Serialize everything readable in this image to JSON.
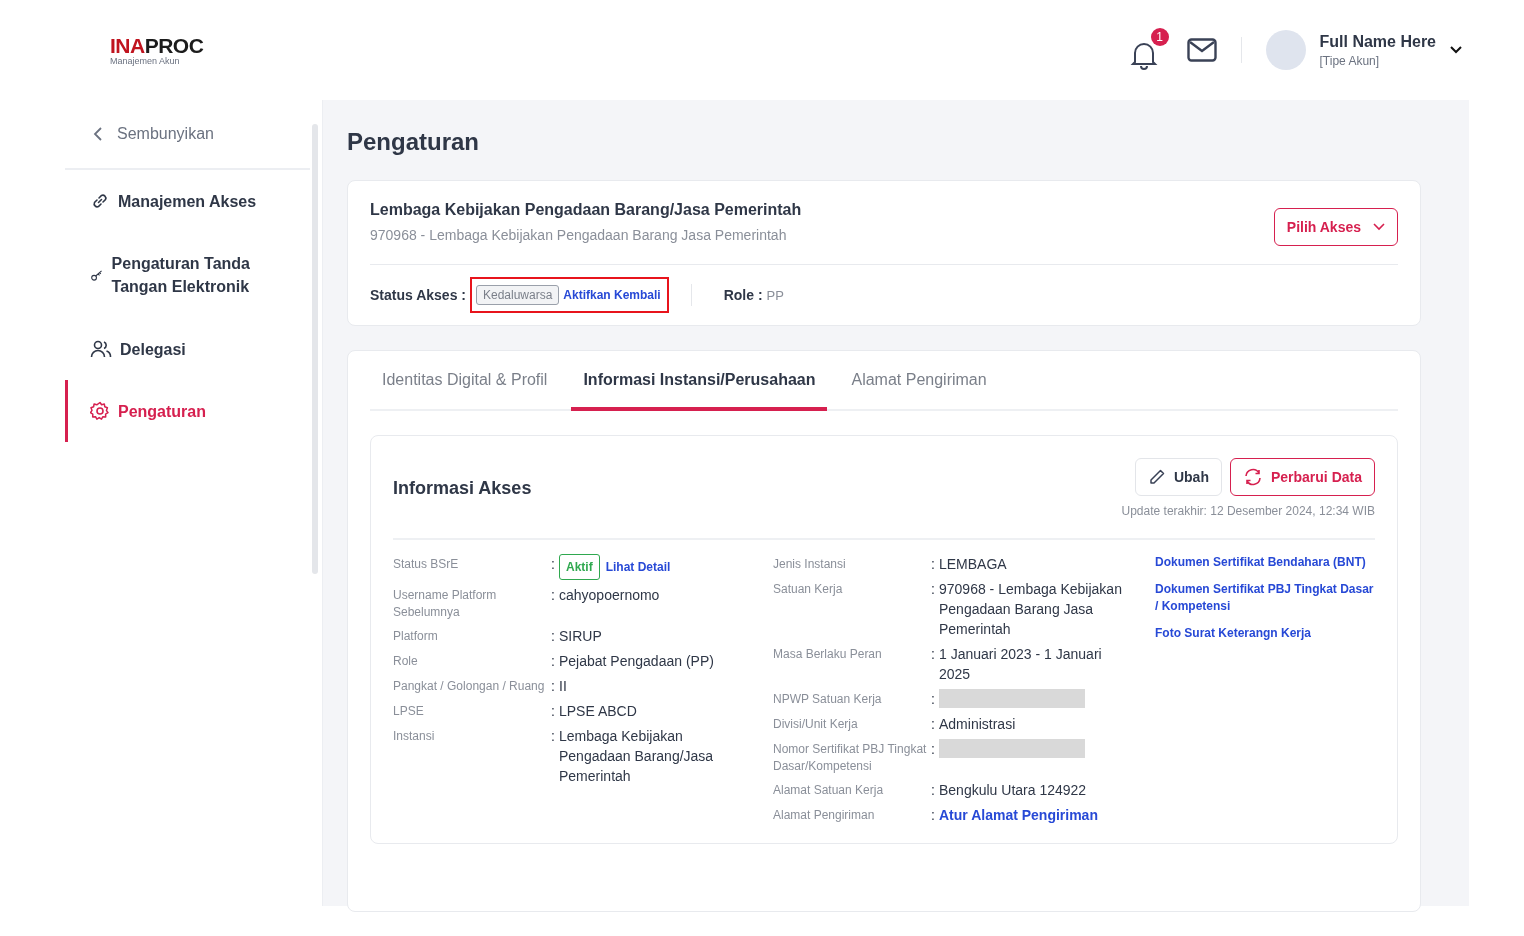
{
  "header": {
    "logo_primary": "INA",
    "logo_secondary": "PROC",
    "logo_caption": "Manajemen Akun",
    "notification_count": "1",
    "user_name": "Full Name Here",
    "user_type": "[Tipe Akun]"
  },
  "sidebar": {
    "collapse_label": "Sembunyikan",
    "items": [
      {
        "label": "Manajemen Akses",
        "kind": "access",
        "selected": false
      },
      {
        "label": "Pengaturan Tanda Tangan Elektronik",
        "kind": "signature",
        "selected": false
      },
      {
        "label": "Delegasi",
        "kind": "delegation",
        "selected": false
      },
      {
        "label": "Pengaturan",
        "kind": "settings",
        "selected": true
      }
    ]
  },
  "page_title": "Pengaturan",
  "access_card": {
    "org_name": "Lembaga Kebijakan Pengadaan Barang/Jasa Pemerintah",
    "org_code": "970968 - Lembaga Kebijakan Pengadaan Barang Jasa Pemerintah",
    "select_button": "Pilih Akses",
    "status_label": "Status Akses :",
    "status_badge": "Kedaluwarsa",
    "status_link": "Aktifkan Kembali",
    "highlighted": true,
    "role_label": "Role :",
    "role_value": "PP"
  },
  "tabs": [
    {
      "label": "Identitas Digital & Profil",
      "selected": false
    },
    {
      "label": "Informasi Instansi/Perusahaan",
      "selected": true
    },
    {
      "label": "Alamat Pengiriman",
      "selected": false
    }
  ],
  "info": {
    "title": "Informasi Akses",
    "edit_button": "Ubah",
    "refresh_button": "Perbarui Data",
    "last_update": "Update terakhir: 12 Desember 2024, 12:34 WIB",
    "separator": ":",
    "left_fields": [
      {
        "label": "Status BSrE",
        "kind": "badge",
        "badge": "Aktif",
        "link": "Lihat Detail"
      },
      {
        "label": "Username Platform Sebelumnya",
        "kind": "text",
        "value": "cahyopoernomo"
      },
      {
        "label": "Platform",
        "kind": "text",
        "value": "SIRUP"
      },
      {
        "label": "Role",
        "kind": "text",
        "value": "Pejabat Pengadaan (PP)"
      },
      {
        "label": "Pangkat / Golongan / Ruang",
        "kind": "text",
        "value": "II"
      },
      {
        "label": "LPSE",
        "kind": "text",
        "value": "LPSE ABCD"
      },
      {
        "label": "Instansi",
        "kind": "text",
        "value": "Lembaga Kebijakan Pengadaan Barang/Jasa Pemerintah"
      }
    ],
    "middle_fields": [
      {
        "label": "Jenis Instansi",
        "kind": "text",
        "value": "LEMBAGA"
      },
      {
        "label": "Satuan Kerja",
        "kind": "text",
        "value": "970968 - Lembaga Kebijakan Pengadaan Barang Jasa Pemerintah"
      },
      {
        "label": "Masa Berlaku Peran",
        "kind": "text",
        "value": "1 Januari 2023 - 1 Januari 2025"
      },
      {
        "label": "NPWP Satuan Kerja",
        "kind": "redacted"
      },
      {
        "label": "Divisi/Unit Kerja",
        "kind": "text",
        "value": "Administrasi"
      },
      {
        "label": "Nomor Sertifikat PBJ Tingkat Dasar/Kompetensi",
        "kind": "redacted"
      },
      {
        "label": "Alamat Satuan Kerja",
        "kind": "text",
        "value": "Bengkulu Utara 124922"
      },
      {
        "label": "Alamat Pengiriman",
        "kind": "link",
        "value": "Atur Alamat Pengiriman"
      }
    ],
    "document_links": [
      "Dokumen Sertifikat Bendahara (BNT)",
      "Dokumen Sertifikat PBJ Tingkat Dasar / Kompetensi",
      "Foto Surat Keterangn Kerja"
    ]
  }
}
